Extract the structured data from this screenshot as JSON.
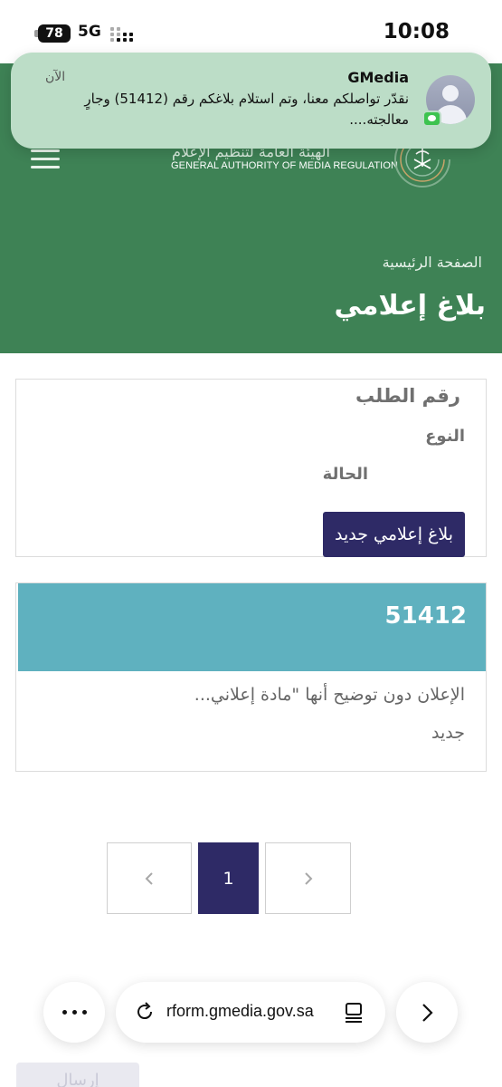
{
  "status_bar": {
    "battery": "78",
    "network": "5G",
    "time": "10:08"
  },
  "header": {
    "org_name_ar": "الهيئة العامة لتنظيم الإعلام",
    "org_name_en": "GENERAL AUTHORITY OF MEDIA REGULATION",
    "breadcrumb": "الصفحة الرئيسية",
    "title": "بلاغ إعلامي",
    "background_color": "#3e8255"
  },
  "notification": {
    "app": "GMedia",
    "time": "الآن",
    "body": "نقدّر تواصلكم معنا، وتم استلام بلاغكم رقم (51412) وجارٍ معالجته....",
    "avatar_icon": "person-icon",
    "badge_icon": "messages-icon"
  },
  "filters": {
    "order_number_label": "رقم الطلب",
    "type_label": "النوع",
    "status_label": "الحالة",
    "new_report_button": "بلاغ إعلامي جديد",
    "button_color": "#2e2a66"
  },
  "report": {
    "number": "51412",
    "description": "الإعلان دون توضيح أنها \"مادة إعلاني...",
    "status": "جديد",
    "header_color": "#5fb1bf"
  },
  "pagination": {
    "prev_icon": "chevron-left-icon",
    "current_page": "1",
    "next_icon": "chevron-right-icon"
  },
  "browser": {
    "url": "rform.gmedia.gov.sa",
    "more_icon": "more-dots-icon",
    "reload_icon": "reload-icon",
    "reader_icon": "reader-mode-icon",
    "forward_icon": "forward-chevron-icon"
  },
  "footer_button": "إرسال"
}
